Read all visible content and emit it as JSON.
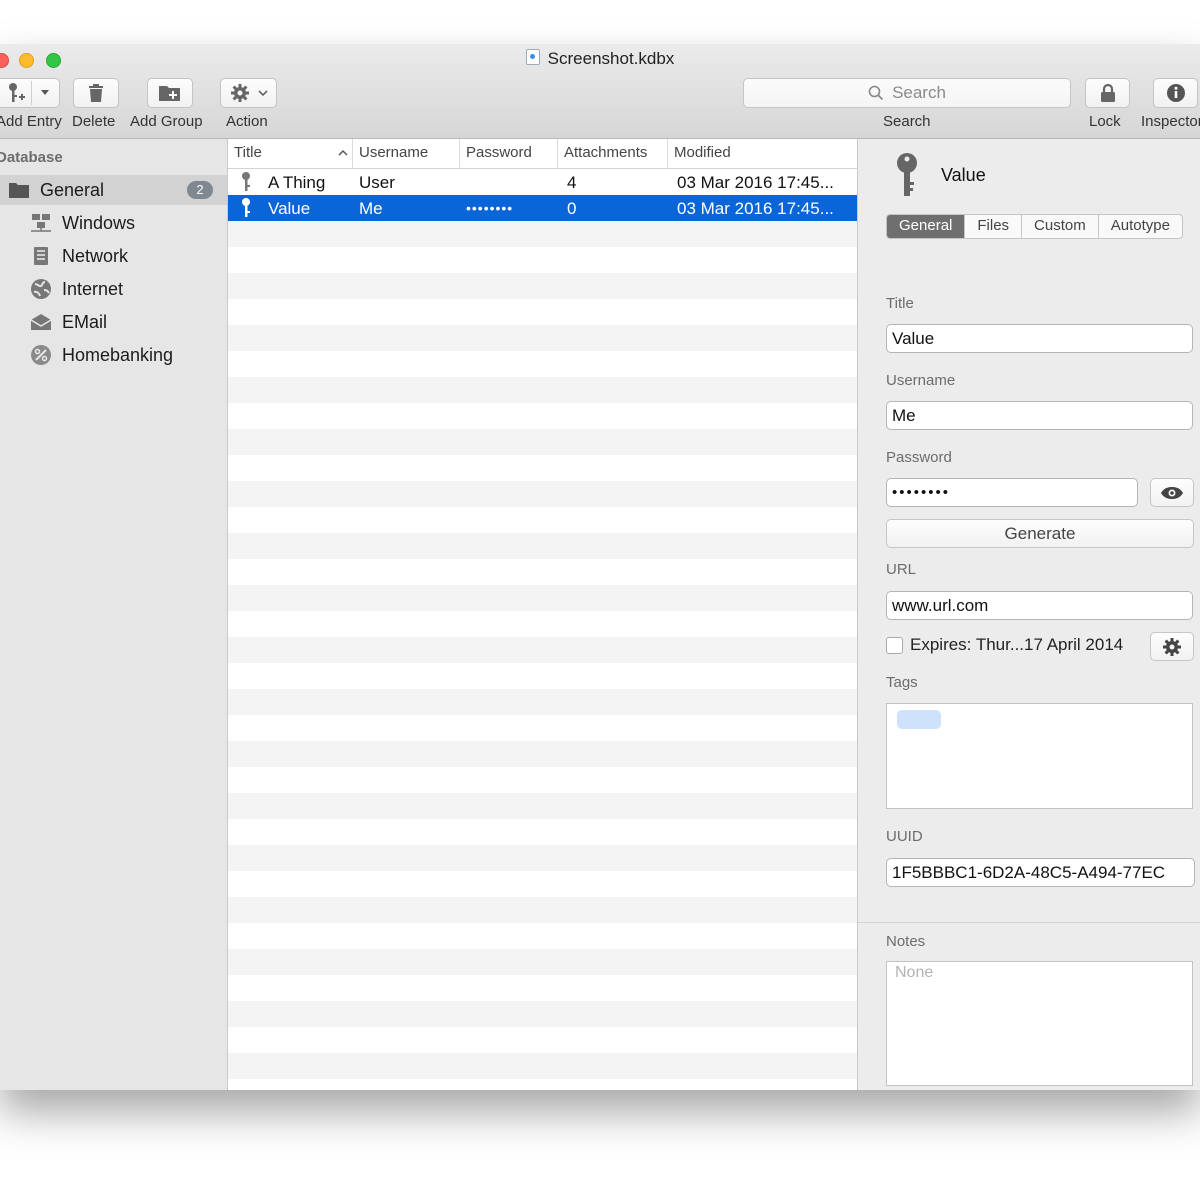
{
  "window": {
    "title": "Screenshot.kdbx"
  },
  "toolbar": {
    "add_entry_label": "Add Entry",
    "delete_label": "Delete",
    "add_group_label": "Add Group",
    "action_label": "Action",
    "search_placeholder": "Search",
    "search_label": "Search",
    "lock_label": "Lock",
    "inspector_label": "Inspector"
  },
  "sidebar": {
    "header": "Database",
    "items": [
      {
        "label": "General",
        "badge": "2",
        "icon": "folder-icon",
        "selected": true
      },
      {
        "label": "Windows",
        "icon": "windows-network-icon"
      },
      {
        "label": "Network",
        "icon": "server-icon"
      },
      {
        "label": "Internet",
        "icon": "globe-icon"
      },
      {
        "label": "EMail",
        "icon": "envelope-icon"
      },
      {
        "label": "Homebanking",
        "icon": "percent-icon"
      }
    ]
  },
  "table": {
    "columns": [
      "Title",
      "Username",
      "Password",
      "Attachments",
      "Modified"
    ],
    "sort_column": "Title",
    "rows": [
      {
        "title": "A Thing",
        "username": "User",
        "password": "",
        "attachments": "4",
        "modified": "03 Mar 2016 17:45..."
      },
      {
        "title": "Value",
        "username": "Me",
        "password": "••••••••",
        "attachments": "0",
        "modified": "03 Mar 2016 17:45...",
        "selected": true
      }
    ]
  },
  "inspector": {
    "title": "Value",
    "tabs": [
      "General",
      "Files",
      "Custom",
      "Autotype"
    ],
    "active_tab": "General",
    "title_label": "Title",
    "title_value": "Value",
    "username_label": "Username",
    "username_value": "Me",
    "password_label": "Password",
    "password_value": "••••••••",
    "generate_label": "Generate",
    "url_label": "URL",
    "url_value": "www.url.com",
    "expires_label": "Expires: Thur...17 April 2014",
    "expires_checked": false,
    "tags_label": "Tags",
    "uuid_label": "UUID",
    "uuid_value": "1F5BBBC1-6D2A-48C5-A494-77EC",
    "notes_label": "Notes",
    "notes_placeholder": "None"
  },
  "colors": {
    "selection": "#0a65d8",
    "badge": "#7f8791"
  }
}
